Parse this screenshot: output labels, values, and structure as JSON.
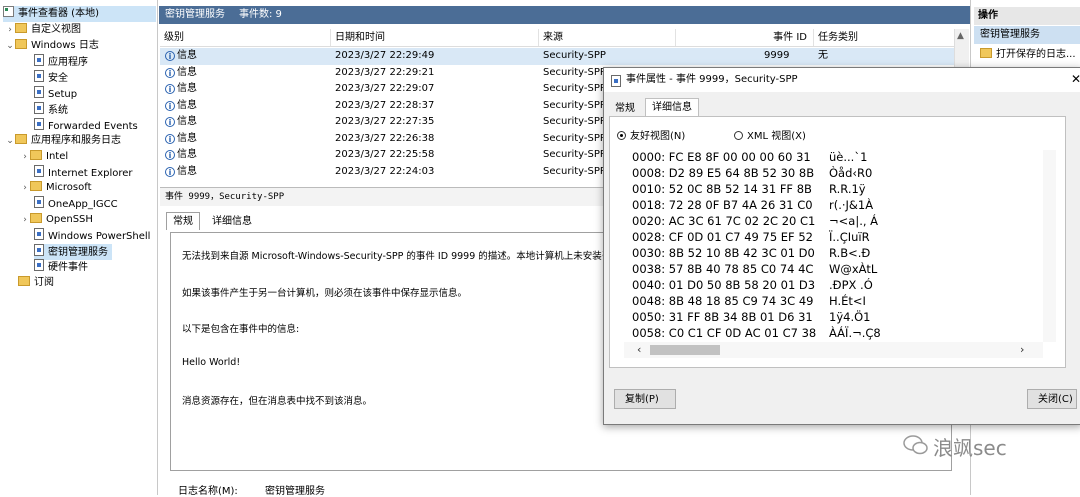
{
  "tree": {
    "root": "事件查看器 (本地)",
    "custom_views": "自定义视图",
    "windows_logs": "Windows 日志",
    "windows_children": [
      "应用程序",
      "安全",
      "Setup",
      "系统",
      "Forwarded Events"
    ],
    "apps_services": "应用程序和服务日志",
    "apps_children": [
      "Intel",
      "Internet Explorer",
      "Microsoft",
      "OneApp_IGCC",
      "OpenSSH",
      "Windows PowerShell",
      "密钥管理服务",
      "硬件事件"
    ],
    "subscriptions": "订阅"
  },
  "list": {
    "title": "密钥管理服务",
    "count_label": "事件数: 9",
    "columns": [
      "级别",
      "日期和时间",
      "来源",
      "事件 ID",
      "任务类别"
    ],
    "rows": [
      {
        "level": "信息",
        "date": "2023/3/27 22:29:49",
        "source": "Security-SPP",
        "id": "9999",
        "task": "无"
      },
      {
        "level": "信息",
        "date": "2023/3/27 22:29:21",
        "source": "Security-SPP"
      },
      {
        "level": "信息",
        "date": "2023/3/27 22:29:07",
        "source": "Security-SPP"
      },
      {
        "level": "信息",
        "date": "2023/3/27 22:28:37",
        "source": "Security-SPP"
      },
      {
        "level": "信息",
        "date": "2023/3/27 22:27:35",
        "source": "Security-SPP"
      },
      {
        "level": "信息",
        "date": "2023/3/27 22:26:38",
        "source": "Security-SPP"
      },
      {
        "level": "信息",
        "date": "2023/3/27 22:25:58",
        "source": "Security-SPP"
      },
      {
        "level": "信息",
        "date": "2023/3/27 22:24:03",
        "source": "Security-SPP"
      }
    ]
  },
  "detail": {
    "header": "事件 9999，Security-SPP",
    "tabs": [
      "常规",
      "详细信息"
    ],
    "lines": [
      "无法找到来自源 Microsoft-Windows-Security-SPP 的事件 ID 9999 的描述。本地计算机上未安装引",
      "如果该事件产生于另一台计算机，则必须在该事件中保存显示信息。",
      "以下是包含在事件中的信息:",
      "Hello World!",
      "消息资源存在，但在消息表中找不到该消息。"
    ],
    "log_name_label": "日志名称(M):",
    "log_name_value": "密钥管理服务"
  },
  "actions": {
    "header": "操作",
    "selected": "密钥管理服务",
    "open_saved": "打开保存的日志..."
  },
  "dialog": {
    "title": "事件属性 - 事件 9999，Security-SPP",
    "tabs": [
      "常规",
      "详细信息"
    ],
    "radio_friendly": "友好视图(N)",
    "radio_xml": "XML 视图(X)",
    "hex_lines": [
      {
        "hex": "0000: FC E8 8F 00 00 00 60 31",
        "ascii": "üè...`1"
      },
      {
        "hex": "0008: D2 89 E5 64 8B 52 30 8B",
        "ascii": "Òåd‹R0"
      },
      {
        "hex": "0010: 52 0C 8B 52 14 31 FF 8B",
        "ascii": "R.R.1ÿ"
      },
      {
        "hex": "0018: 72 28 0F B7 4A 26 31 C0",
        "ascii": "r(.·J&1À"
      },
      {
        "hex": "0020: AC 3C 61 7C 02 2C 20 C1",
        "ascii": "¬<a|., Á"
      },
      {
        "hex": "0028: CF 0D 01 C7 49 75 EF 52",
        "ascii": "Ï..ÇIuïR"
      },
      {
        "hex": "0030: 8B 52 10 8B 42 3C 01 D0",
        "ascii": "R.B<.Ð"
      },
      {
        "hex": "0038: 57 8B 40 78 85 C0 74 4C",
        "ascii": "W@xÀtL"
      },
      {
        "hex": "0040: 01 D0 50 8B 58 20 01 D3",
        "ascii": ".ÐPX .Ó"
      },
      {
        "hex": "0048: 8B 48 18 85 C9 74 3C 49",
        "ascii": "H.Ét<I"
      },
      {
        "hex": "0050: 31 FF 8B 34 8B 01 D6 31",
        "ascii": "1ÿ4.Ö1"
      },
      {
        "hex": "0058: C0 C1 CF 0D AC 01 C7 38",
        "ascii": "ÀÁÏ.¬.Ç8"
      }
    ],
    "copy_button": "复制(P)",
    "close_button": "关闭(C)"
  },
  "watermark": "浪飒sec"
}
